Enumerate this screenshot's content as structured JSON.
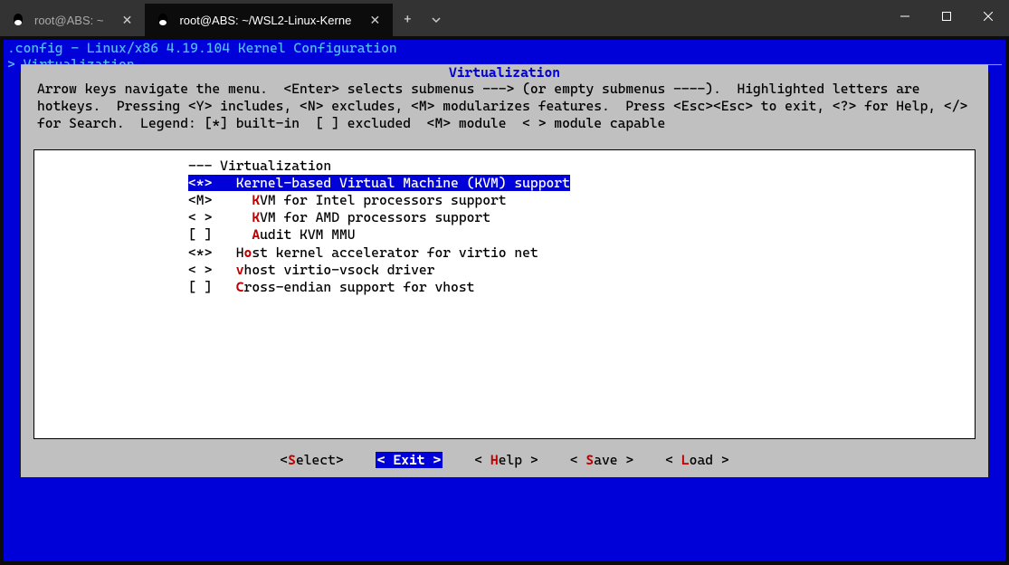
{
  "tabs": [
    {
      "title": "root@ABS: ~",
      "active": false
    },
    {
      "title": "root@ABS: ~/WSL2-Linux-Kerne",
      "active": true
    }
  ],
  "config_title": ".config - Linux/x86 4.19.104 Kernel Configuration",
  "breadcrumb": "> Virtualization",
  "dialog_title": "Virtualization",
  "help_text": "Arrow keys navigate the menu.  <Enter> selects submenus ---> (or empty submenus ----).  Highlighted letters are hotkeys.  Pressing <Y> includes, <N> excludes, <M> modularizes features.  Press <Esc><Esc> to exit, <?> for Help, </> for Search.  Legend: [*] built-in  [ ] excluded  <M> module  < > module capable",
  "menu": [
    {
      "prefix": "--- ",
      "hot": "",
      "label": "Virtualization",
      "selected": false
    },
    {
      "prefix": "<*>   ",
      "hot": "",
      "label": "Kernel-based Virtual Machine (KVM) support",
      "selected": true
    },
    {
      "prefix": "<M>     ",
      "hot": "K",
      "label": "VM for Intel processors support",
      "selected": false
    },
    {
      "prefix": "< >     ",
      "hot": "K",
      "label": "VM for AMD processors support",
      "selected": false
    },
    {
      "prefix": "[ ]     ",
      "hot": "A",
      "label": "udit KVM MMU",
      "selected": false
    },
    {
      "prefix": "<*>   H",
      "hot": "o",
      "label": "st kernel accelerator for virtio net",
      "selected": false
    },
    {
      "prefix": "< >   ",
      "hot": "v",
      "label": "host virtio-vsock driver",
      "selected": false
    },
    {
      "prefix": "[ ]   ",
      "hot": "C",
      "label": "ross-endian support for vhost",
      "selected": false
    }
  ],
  "buttons": {
    "select": {
      "pre": "<",
      "hot": "S",
      "post": "elect>"
    },
    "exit": {
      "label": "< Exit >"
    },
    "help": {
      "pre": "< ",
      "hot": "H",
      "post": "elp >"
    },
    "save": {
      "pre": "< ",
      "hot": "S",
      "post": "ave >"
    },
    "load": {
      "pre": "< ",
      "hot": "L",
      "post": "oad >"
    }
  }
}
